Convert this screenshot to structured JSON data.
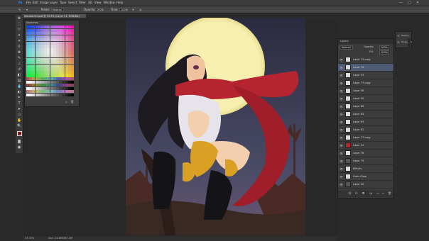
{
  "menubar": {
    "items": [
      "File",
      "Edit",
      "Image",
      "Layer",
      "Type",
      "Select",
      "Filter",
      "3D",
      "View",
      "Window",
      "Help"
    ],
    "window_controls": [
      "—",
      "▢",
      "✕"
    ]
  },
  "options": {
    "mode_label": "Mode:",
    "mode_value": "Normal",
    "opacity_label": "Opacity:",
    "opacity_value": "100%",
    "flow_label": "Flow:",
    "flow_value": "100%"
  },
  "document": {
    "tab_title": "Nezuko-hd.psd @ 33.3% (Layer 51, RGB/8#)"
  },
  "swatches": {
    "title": "Swatches"
  },
  "layers": {
    "header": "Layers",
    "mode_value": "Normal",
    "opacity_label": "Opacity:",
    "opacity_value": "100%",
    "fill_label": "Fill:",
    "fill_value": "100%",
    "rows": [
      {
        "name": "Layer 73 copy"
      },
      {
        "name": "Layer 74"
      },
      {
        "name": "Layer 53"
      },
      {
        "name": "Layer 77 copy"
      },
      {
        "name": "Layer 56"
      },
      {
        "name": "Layer 55"
      },
      {
        "name": "Layer 66"
      },
      {
        "name": "Layer 64"
      },
      {
        "name": "Layer 63"
      },
      {
        "name": "Layer 62"
      },
      {
        "name": "Layer 77 copy"
      },
      {
        "name": "Layer 21"
      },
      {
        "name": "Layer 78"
      },
      {
        "name": "Layer 79"
      },
      {
        "name": "Effects"
      },
      {
        "name": "Color Glow"
      },
      {
        "name": "Layer 40"
      }
    ],
    "active_index": 1
  },
  "dock": {
    "items": [
      "History",
      "Properties"
    ]
  },
  "status": {
    "zoom": "33.33%",
    "doc": "Doc: 24.6M/387.4M"
  },
  "colors": {
    "foreground": "#8b1a1a",
    "background": "#ffffff",
    "moon": "#f6efb0",
    "sky": "#3b3d55",
    "scarf": "#b52430"
  }
}
